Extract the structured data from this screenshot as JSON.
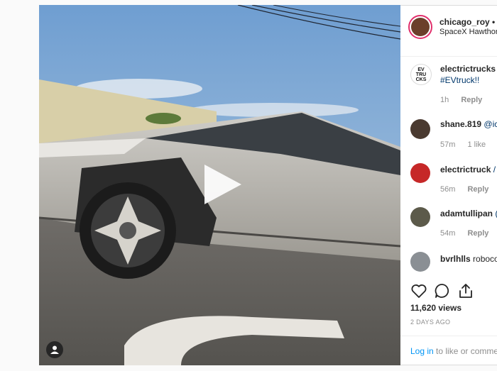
{
  "post": {
    "username": "chicago_roy",
    "dot": "•",
    "location": "SpaceX Hawthorne"
  },
  "comments": [
    {
      "user": "electrictrucks",
      "text": "@i",
      "tag": "#EVtruck!!",
      "time": "1h",
      "likes": "",
      "reply": "Reply"
    },
    {
      "user": "shane.819",
      "text": "@ic",
      "time": "57m",
      "likes": "1 like",
      "reply": "Reply"
    },
    {
      "user": "electrictruck",
      "text": "/",
      "time": "56m",
      "likes": "",
      "reply": "Reply"
    },
    {
      "user": "adamtullipan",
      "text": "(",
      "time": "54m",
      "likes": "",
      "reply": "Reply"
    },
    {
      "user": "bvrlhlls",
      "text": "roboco",
      "time": "",
      "likes": "",
      "reply": ""
    }
  ],
  "avatar_label": "EV TRU CKS",
  "stats": {
    "views": "11,620 views",
    "date": "2 DAYS AGO"
  },
  "login": {
    "link": "Log in",
    "rest": " to like or comme"
  },
  "icons": {
    "play": "play-icon",
    "like": "heart-icon",
    "comment": "comment-icon",
    "share": "share-icon",
    "user_tag": "user-tag-icon"
  },
  "colors": {
    "accent_link": "#0095f6",
    "text_primary": "#262626",
    "text_secondary": "#8e8e8e",
    "ring": "#e1306c"
  }
}
